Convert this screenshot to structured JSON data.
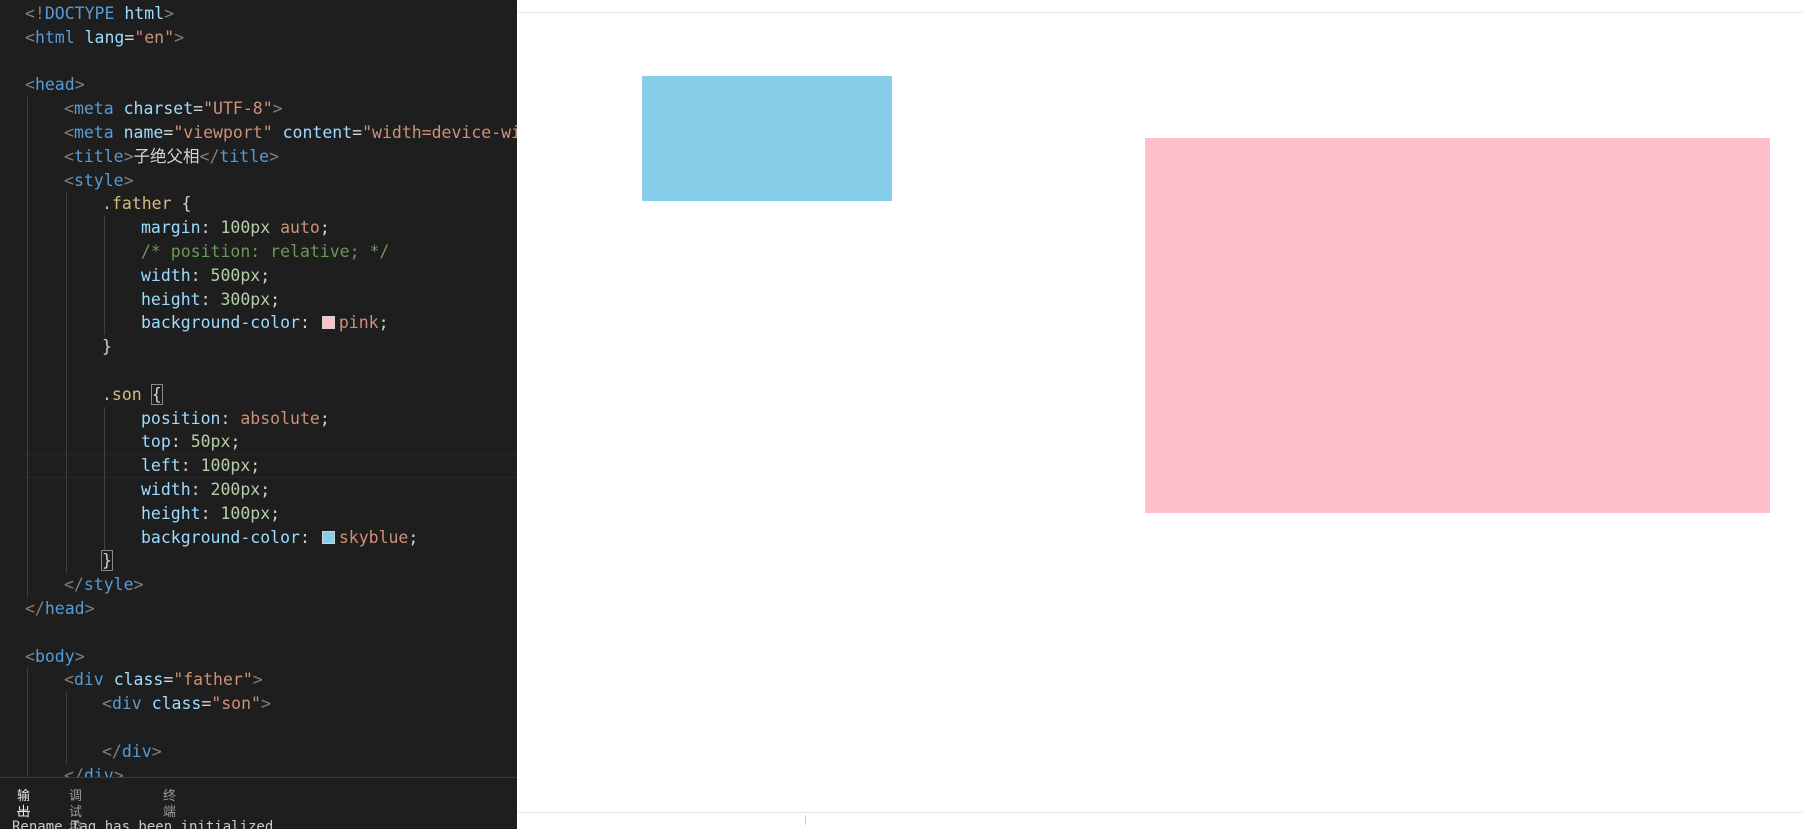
{
  "editor": {
    "lines": [
      {
        "indent": 0,
        "guides": [],
        "tokens": [
          {
            "t": "<!",
            "c": "punct"
          },
          {
            "t": "DOCTYPE",
            "c": "tag"
          },
          {
            "t": " ",
            "c": "text"
          },
          {
            "t": "html",
            "c": "attr"
          },
          {
            "t": ">",
            "c": "punct"
          }
        ]
      },
      {
        "indent": 0,
        "guides": [],
        "tokens": [
          {
            "t": "<",
            "c": "punct"
          },
          {
            "t": "html",
            "c": "tag"
          },
          {
            "t": " ",
            "c": "text"
          },
          {
            "t": "lang",
            "c": "attr"
          },
          {
            "t": "=",
            "c": "text"
          },
          {
            "t": "\"en\"",
            "c": "str"
          },
          {
            "t": ">",
            "c": "punct"
          }
        ]
      },
      {
        "indent": 0,
        "guides": [],
        "tokens": []
      },
      {
        "indent": 0,
        "guides": [],
        "tokens": [
          {
            "t": "<",
            "c": "punct"
          },
          {
            "t": "head",
            "c": "tag"
          },
          {
            "t": ">",
            "c": "punct"
          }
        ]
      },
      {
        "indent": 1,
        "guides": [
          1
        ],
        "tokens": [
          {
            "t": "<",
            "c": "punct"
          },
          {
            "t": "meta",
            "c": "tag"
          },
          {
            "t": " ",
            "c": "text"
          },
          {
            "t": "charset",
            "c": "attr"
          },
          {
            "t": "=",
            "c": "text"
          },
          {
            "t": "\"UTF-8\"",
            "c": "str"
          },
          {
            "t": ">",
            "c": "punct"
          }
        ]
      },
      {
        "indent": 1,
        "guides": [
          1
        ],
        "tokens": [
          {
            "t": "<",
            "c": "punct"
          },
          {
            "t": "meta",
            "c": "tag"
          },
          {
            "t": " ",
            "c": "text"
          },
          {
            "t": "name",
            "c": "attr"
          },
          {
            "t": "=",
            "c": "text"
          },
          {
            "t": "\"viewport\"",
            "c": "str"
          },
          {
            "t": " ",
            "c": "text"
          },
          {
            "t": "content",
            "c": "attr"
          },
          {
            "t": "=",
            "c": "text"
          },
          {
            "t": "\"width=device-wid",
            "c": "str"
          }
        ]
      },
      {
        "indent": 1,
        "guides": [
          1
        ],
        "tokens": [
          {
            "t": "<",
            "c": "punct"
          },
          {
            "t": "title",
            "c": "tag"
          },
          {
            "t": ">",
            "c": "punct"
          },
          {
            "t": "子绝父相",
            "c": "text"
          },
          {
            "t": "</",
            "c": "punct"
          },
          {
            "t": "title",
            "c": "tag"
          },
          {
            "t": ">",
            "c": "punct"
          }
        ]
      },
      {
        "indent": 1,
        "guides": [
          1
        ],
        "tokens": [
          {
            "t": "<",
            "c": "punct"
          },
          {
            "t": "style",
            "c": "tag"
          },
          {
            "t": ">",
            "c": "punct"
          }
        ]
      },
      {
        "indent": 2,
        "guides": [
          1,
          2
        ],
        "tokens": [
          {
            "t": ".father",
            "c": "sel"
          },
          {
            "t": " {",
            "c": "brace"
          }
        ]
      },
      {
        "indent": 3,
        "guides": [
          1,
          2,
          3
        ],
        "tokens": [
          {
            "t": "margin",
            "c": "prop"
          },
          {
            "t": ": ",
            "c": "text"
          },
          {
            "t": "100px",
            "c": "num"
          },
          {
            "t": " ",
            "c": "text"
          },
          {
            "t": "auto",
            "c": "val"
          },
          {
            "t": ";",
            "c": "text"
          }
        ]
      },
      {
        "indent": 3,
        "guides": [
          1,
          2,
          3
        ],
        "tokens": [
          {
            "t": "/* position: relative; */",
            "c": "comment"
          }
        ]
      },
      {
        "indent": 3,
        "guides": [
          1,
          2,
          3
        ],
        "tokens": [
          {
            "t": "width",
            "c": "prop"
          },
          {
            "t": ": ",
            "c": "text"
          },
          {
            "t": "500px",
            "c": "num"
          },
          {
            "t": ";",
            "c": "text"
          }
        ]
      },
      {
        "indent": 3,
        "guides": [
          1,
          2,
          3
        ],
        "tokens": [
          {
            "t": "height",
            "c": "prop"
          },
          {
            "t": ": ",
            "c": "text"
          },
          {
            "t": "300px",
            "c": "num"
          },
          {
            "t": ";",
            "c": "text"
          }
        ]
      },
      {
        "indent": 3,
        "guides": [
          1,
          2,
          3
        ],
        "tokens": [
          {
            "t": "background-color",
            "c": "prop"
          },
          {
            "t": ": ",
            "c": "text"
          },
          {
            "t": "",
            "c": "swatch",
            "color": "#ffc0cb"
          },
          {
            "t": "pink",
            "c": "val"
          },
          {
            "t": ";",
            "c": "text"
          }
        ]
      },
      {
        "indent": 2,
        "guides": [
          1,
          2
        ],
        "tokens": [
          {
            "t": "}",
            "c": "brace"
          }
        ]
      },
      {
        "indent": 2,
        "guides": [
          1,
          2
        ],
        "tokens": []
      },
      {
        "indent": 2,
        "guides": [
          1,
          2
        ],
        "tokens": [
          {
            "t": ".son",
            "c": "sel"
          },
          {
            "t": " ",
            "c": "text"
          },
          {
            "t": "{",
            "c": "brace",
            "match": true
          }
        ]
      },
      {
        "indent": 3,
        "guides": [
          1,
          2,
          3
        ],
        "tokens": [
          {
            "t": "position",
            "c": "prop"
          },
          {
            "t": ": ",
            "c": "text"
          },
          {
            "t": "absolute",
            "c": "val"
          },
          {
            "t": ";",
            "c": "text"
          }
        ]
      },
      {
        "indent": 3,
        "guides": [
          1,
          2,
          3
        ],
        "tokens": [
          {
            "t": "top",
            "c": "prop"
          },
          {
            "t": ": ",
            "c": "text"
          },
          {
            "t": "50px",
            "c": "num"
          },
          {
            "t": ";",
            "c": "text"
          }
        ]
      },
      {
        "indent": 3,
        "guides": [
          1,
          2,
          3
        ],
        "current": true,
        "tokens": [
          {
            "t": "left",
            "c": "prop"
          },
          {
            "t": ": ",
            "c": "text"
          },
          {
            "t": "100px",
            "c": "num"
          },
          {
            "t": ";",
            "c": "text"
          }
        ]
      },
      {
        "indent": 3,
        "guides": [
          1,
          2,
          3
        ],
        "tokens": [
          {
            "t": "width",
            "c": "prop"
          },
          {
            "t": ": ",
            "c": "text"
          },
          {
            "t": "200px",
            "c": "num"
          },
          {
            "t": ";",
            "c": "text"
          }
        ]
      },
      {
        "indent": 3,
        "guides": [
          1,
          2,
          3
        ],
        "tokens": [
          {
            "t": "height",
            "c": "prop"
          },
          {
            "t": ": ",
            "c": "text"
          },
          {
            "t": "100px",
            "c": "num"
          },
          {
            "t": ";",
            "c": "text"
          }
        ]
      },
      {
        "indent": 3,
        "guides": [
          1,
          2,
          3
        ],
        "tokens": [
          {
            "t": "background-color",
            "c": "prop"
          },
          {
            "t": ": ",
            "c": "text"
          },
          {
            "t": "",
            "c": "swatch",
            "color": "#87ceeb"
          },
          {
            "t": "skyblue",
            "c": "val"
          },
          {
            "t": ";",
            "c": "text"
          }
        ]
      },
      {
        "indent": 2,
        "guides": [
          1,
          2
        ],
        "tokens": [
          {
            "t": "}",
            "c": "brace",
            "match": true
          }
        ]
      },
      {
        "indent": 1,
        "guides": [
          1
        ],
        "tokens": [
          {
            "t": "</",
            "c": "punct"
          },
          {
            "t": "style",
            "c": "tag"
          },
          {
            "t": ">",
            "c": "punct"
          }
        ]
      },
      {
        "indent": 0,
        "guides": [],
        "tokens": [
          {
            "t": "</",
            "c": "punct"
          },
          {
            "t": "head",
            "c": "tag"
          },
          {
            "t": ">",
            "c": "punct"
          }
        ]
      },
      {
        "indent": 0,
        "guides": [],
        "tokens": []
      },
      {
        "indent": 0,
        "guides": [],
        "tokens": [
          {
            "t": "<",
            "c": "punct"
          },
          {
            "t": "body",
            "c": "tag"
          },
          {
            "t": ">",
            "c": "punct"
          }
        ]
      },
      {
        "indent": 1,
        "guides": [
          1
        ],
        "tokens": [
          {
            "t": "<",
            "c": "punct"
          },
          {
            "t": "div",
            "c": "tag"
          },
          {
            "t": " ",
            "c": "text"
          },
          {
            "t": "class",
            "c": "attr"
          },
          {
            "t": "=",
            "c": "text"
          },
          {
            "t": "\"father\"",
            "c": "str"
          },
          {
            "t": ">",
            "c": "punct"
          }
        ]
      },
      {
        "indent": 2,
        "guides": [
          1,
          2
        ],
        "tokens": [
          {
            "t": "<",
            "c": "punct"
          },
          {
            "t": "div",
            "c": "tag"
          },
          {
            "t": " ",
            "c": "text"
          },
          {
            "t": "class",
            "c": "attr"
          },
          {
            "t": "=",
            "c": "text"
          },
          {
            "t": "\"son\"",
            "c": "str"
          },
          {
            "t": ">",
            "c": "punct"
          }
        ]
      },
      {
        "indent": 2,
        "guides": [
          1,
          2
        ],
        "tokens": []
      },
      {
        "indent": 2,
        "guides": [
          1,
          2
        ],
        "tokens": [
          {
            "t": "</",
            "c": "punct"
          },
          {
            "t": "div",
            "c": "tag"
          },
          {
            "t": ">",
            "c": "punct"
          }
        ]
      },
      {
        "indent": 1,
        "guides": [
          1
        ],
        "tokens": [
          {
            "t": "</",
            "c": "punct"
          },
          {
            "t": "div",
            "c": "tag"
          },
          {
            "t": ">",
            "c": "punct"
          }
        ]
      }
    ]
  },
  "panel": {
    "tabs": [
      {
        "label": "输出",
        "active": true
      },
      {
        "label": "调试控制台",
        "active": false
      },
      {
        "label": "终端",
        "active": false
      }
    ],
    "output_text": "Rename Tag has been initialized"
  },
  "preview": {
    "son_color": "#87ceeb",
    "father_color": "#ffc0cb"
  }
}
